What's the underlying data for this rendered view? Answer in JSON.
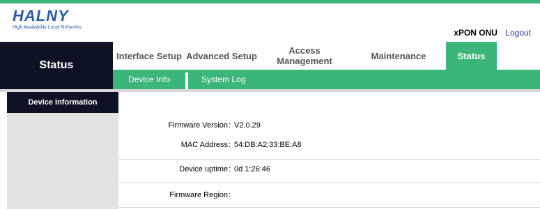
{
  "brand": {
    "logo": "HALNY",
    "tagline": "High Availability Local Networks"
  },
  "header": {
    "product": "xPON ONU",
    "logout": "Logout"
  },
  "section_title": "Status",
  "nav": {
    "tabs": [
      {
        "label": "Interface Setup"
      },
      {
        "label": "Advanced Setup"
      },
      {
        "label": "Access Management"
      },
      {
        "label": "Maintenance"
      },
      {
        "label": "Status"
      }
    ],
    "active_tab": "Status"
  },
  "subnav": {
    "items": [
      {
        "label": "Device Info"
      },
      {
        "label": "System Log"
      }
    ]
  },
  "sidebar": {
    "items": [
      {
        "label": "Device Information"
      }
    ]
  },
  "device_info": {
    "firmware_version": {
      "label": "Firmware Version",
      "value": "V2.0.29"
    },
    "mac_address": {
      "label": "MAC Address",
      "value": "54:DB:A2:33:BE:A8"
    },
    "uptime": {
      "label": "Device uptime",
      "value": "0d 1:26:46"
    },
    "firmware_region": {
      "label": "Firmware Region",
      "value": ""
    }
  },
  "colors": {
    "accent": "#3cb57a",
    "dark": "#0d1324",
    "link": "#1a3aa8",
    "logo": "#2a5aa8"
  }
}
